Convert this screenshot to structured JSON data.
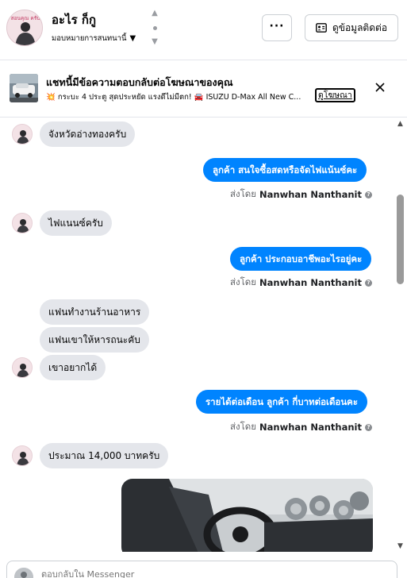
{
  "header": {
    "contact_name": "อะไร ก็กู",
    "assign_label": "มอบหมายการสนทนานี้",
    "more_label": "···",
    "contact_info_label": "ดูข้อมูลติดต่อ",
    "avatar_text": "สอนคุณ ครับ"
  },
  "ad_banner": {
    "title": "แชทนี้มีข้อความตอบกลับต่อโฆษณาของคุณ",
    "description": "💥 กระบะ 4 ประตู สุดประหยัด แรงดีไม่มีตก! 🚘 ISUZU D-Max All New C...",
    "link_label": "ดูโฆษณา"
  },
  "messages": [
    {
      "direction": "in",
      "text": "จังหวัดอ่างทองครับ"
    },
    {
      "direction": "out",
      "text": "ลูกค้า  สนใจซื้อสดหรือจัดไฟแน้นซ์คะ"
    },
    {
      "direction": "in",
      "text": "ไฟแนนซ์ครับ"
    },
    {
      "direction": "out",
      "text": "ลูกค้า ประกอบอาชีพอะไรอยู่คะ"
    },
    {
      "direction": "in",
      "text": "แฟนทำงานร้านอาหาร"
    },
    {
      "direction": "in",
      "text": "แฟนเขาให้หารถนะคับ"
    },
    {
      "direction": "in",
      "text": "เขาอยากได้"
    },
    {
      "direction": "out",
      "text": "รายได้ต่อเดือน  ลูกค้า กี่บาทต่อเดือนคะ"
    },
    {
      "direction": "in",
      "text": "ประมาณ 14,000 บาทครับ"
    }
  ],
  "sent_by": {
    "prefix": "ส่งโดย",
    "name": "Nanwhan Nanthanit"
  },
  "composer": {
    "placeholder": "ตอบกลับใน Messenger"
  }
}
